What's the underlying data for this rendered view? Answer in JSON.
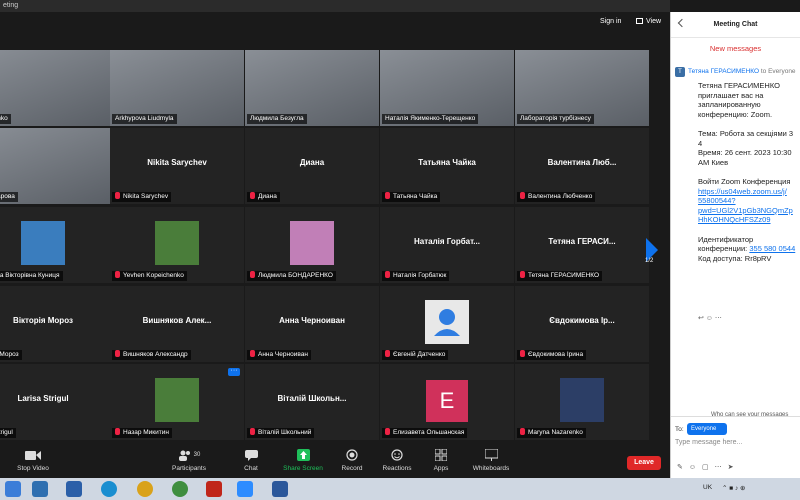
{
  "window": {
    "title": "eting"
  },
  "top": {
    "sign_in": "Sign in",
    "view": "View"
  },
  "tiles": [
    {
      "name": "Nikitenko",
      "label": "Nikitenko",
      "type": "video"
    },
    {
      "name": "Arkhypova Liudmyla",
      "label": "Arkhypova Liudmyla",
      "type": "video",
      "active": true
    },
    {
      "name": "Людмила Безугла",
      "label": "Людмила Безугла",
      "type": "video"
    },
    {
      "name": "Наталія Якименко-Терещенко",
      "label": "Наталія Якименко-Терещенко",
      "type": "video"
    },
    {
      "name": "Лабораторія турбізнесу",
      "label": "Лабораторія турбізнесу",
      "type": "video"
    },
    {
      "name": "Захарова",
      "label": "я Захарова",
      "type": "video"
    },
    {
      "name": "Nikita Sarychev",
      "label": "Nikita Sarychev",
      "type": "name"
    },
    {
      "name": "Диана",
      "label": "Диана",
      "type": "name"
    },
    {
      "name": "Татьяна Чайка",
      "label": "Татьяна Чайка",
      "type": "name"
    },
    {
      "name": "Валентина Любченко",
      "center": "Валентина Люб...",
      "label": "Валентина Любченко",
      "type": "name"
    },
    {
      "name": "Вікторівна Куниця",
      "label": "рина Вікторівна Куниця",
      "type": "picture"
    },
    {
      "name": "Yevhen Kopeichenko",
      "label": "Yevhen Kopeichenko",
      "type": "picture"
    },
    {
      "name": "Людмила БОНДАРЕНКО",
      "label": "Людмила БОНДАРЕНКО",
      "type": "picture"
    },
    {
      "name": "Наталія Горбатюк",
      "center": "Наталія Горбат...",
      "label": "Наталія Горбатюк",
      "type": "name"
    },
    {
      "name": "Тетяна ГЕРАСИМЕНКО",
      "center": "Тетяна ГЕРАСИ...",
      "label": "Тетяна ГЕРАСИМЕНКО",
      "type": "name"
    },
    {
      "name": "Вікторія Мороз",
      "center": "Вікторія Мороз",
      "label": "рія Мороз",
      "type": "name"
    },
    {
      "name": "Вишняков Александр",
      "center": "Вишняков Алек...",
      "label": "Вишняков Александр",
      "type": "name"
    },
    {
      "name": "Анна Черноиван",
      "center": "Анна Черноиван",
      "label": "Анна Черноиван",
      "type": "name"
    },
    {
      "name": "Євгеній Датченко",
      "label": "Євгеній Датченко",
      "type": "default-avatar"
    },
    {
      "name": "Євдокимова Ірина",
      "center": "Євдокимова Ір...",
      "label": "Євдокимова Ірина",
      "type": "name"
    },
    {
      "name": "Larisa Strigul",
      "center": "Larisa Strigul",
      "label": "a Strigul",
      "type": "name"
    },
    {
      "name": "Назар Микитин",
      "label": "Назар Микитин",
      "type": "picture"
    },
    {
      "name": "Віталій Школьний",
      "center": "Віталій Школьн...",
      "label": "Віталій Школьний",
      "type": "name"
    },
    {
      "name": "Елизавета Ольшанская",
      "label": "Елизавета Ольшанская",
      "type": "letter",
      "letter": "E"
    },
    {
      "name": "Maryna Nazarenko",
      "label": "Maryna Nazarenko",
      "type": "picture"
    }
  ],
  "pager": {
    "text": "1/2"
  },
  "toolbar": {
    "stop_video": "Stop Video",
    "participants": "Participants",
    "participants_count": "30",
    "chat": "Chat",
    "share_screen": "Share Screen",
    "record": "Record",
    "reactions": "Reactions",
    "apps": "Apps",
    "whiteboards": "Whiteboards",
    "leave": "Leave"
  },
  "chat": {
    "title": "Meeting Chat",
    "new_messages": "New messages",
    "sender_badge": "T",
    "sender": "Тетяна ГЕРАСИМЕНКО",
    "to_text": "to Everyone",
    "message_lines": [
      "Тетяна ГЕРАСИМЕНКО",
      "приглашает вас на",
      "запланированную",
      "конференцию: Zoom.",
      "",
      "Тема: Робота за секціями 3",
      "4",
      "Время: 26 сент. 2023 10:30",
      "AM Киев",
      "",
      "Войти Zoom Конференция",
      "https://us04web.zoom.us/j/",
      "55800544?",
      "pwd=UGl2V1pGb3NGQmZp",
      "HhKOHNQcHFSZz09",
      "",
      "Идентификатор",
      "конференции: 355 580 0544",
      "Код доступа: Rr8pRV"
    ],
    "who_can_see": "Who can see your messages",
    "to_label": "To:",
    "recipient": "Everyone",
    "input_placeholder": "Type message here..."
  },
  "tray": {
    "lang": "UK"
  }
}
